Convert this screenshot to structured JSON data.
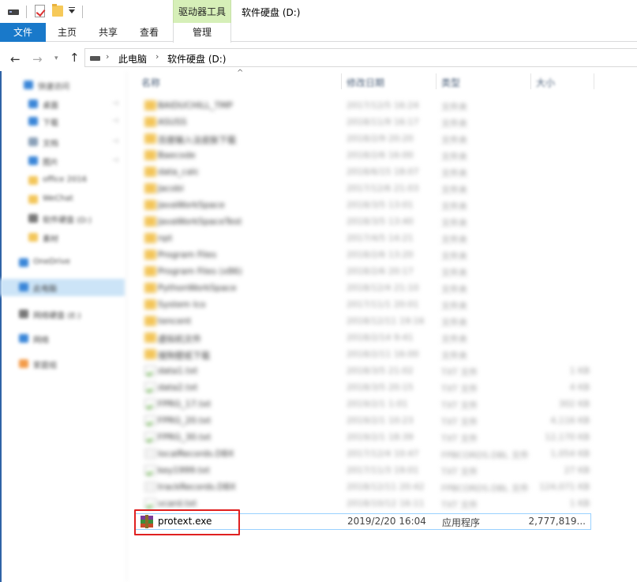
{
  "window": {
    "title": "软件硬盘 (D:)",
    "context_group": "驱动器工具"
  },
  "ribbon": {
    "tabs": [
      {
        "label": "文件",
        "active": true
      },
      {
        "label": "主页"
      },
      {
        "label": "共享"
      },
      {
        "label": "查看"
      },
      {
        "label": "管理"
      }
    ]
  },
  "address": {
    "crumbs": [
      "此电脑",
      "软件硬盘 (D:)"
    ]
  },
  "columns": {
    "name": "名称",
    "date": "修改日期",
    "type": "类型",
    "size": "大小"
  },
  "nav_pane": {
    "items": [
      {
        "label": "快速访问",
        "icon": "star-icon",
        "color": "#3a86d8"
      },
      {
        "label": "桌面",
        "icon": "desktop-icon",
        "color": "#3a86d8",
        "pinned": true
      },
      {
        "label": "下载",
        "icon": "download-icon",
        "color": "#3a86d8",
        "pinned": true
      },
      {
        "label": "文档",
        "icon": "document-icon",
        "color": "#8aa0b8",
        "pinned": true
      },
      {
        "label": "图片",
        "icon": "picture-icon",
        "color": "#3a86d8",
        "pinned": true
      },
      {
        "label": "office 2016",
        "icon": "folder-icon",
        "color": "#f3c65a"
      },
      {
        "label": "WeChat",
        "icon": "folder-icon",
        "color": "#f3c65a"
      },
      {
        "label": "软件硬盘 (D:)",
        "icon": "drive-icon",
        "color": "#777777"
      },
      {
        "label": "素材",
        "icon": "folder-icon",
        "color": "#f3c65a"
      },
      {
        "label": "OneDrive",
        "icon": "cloud-icon",
        "color": "#3a86d8"
      },
      {
        "label": "此电脑",
        "icon": "computer-icon",
        "color": "#3a86d8",
        "selected": true
      },
      {
        "label": "网络硬盘 (E:)",
        "icon": "drive-icon",
        "color": "#777777"
      },
      {
        "label": "网络",
        "icon": "network-icon",
        "color": "#3a86d8"
      },
      {
        "label": "家庭组",
        "icon": "homegroup-icon",
        "color": "#f39c4a"
      }
    ]
  },
  "files_blurred": [
    {
      "name": "BAIDUCHILL_TMP",
      "date": "2017/12/5 16:24",
      "type": "文件夹",
      "size": "",
      "kind": "folder"
    },
    {
      "name": "ASUSS",
      "date": "2018/11/9 16:17",
      "type": "文件夹",
      "size": "",
      "kind": "folder"
    },
    {
      "name": "百度输入法皮肤下载",
      "date": "2018/2/9 20:20",
      "type": "文件夹",
      "size": "",
      "kind": "folder"
    },
    {
      "name": "Baecode",
      "date": "2018/2/6 16:00",
      "type": "文件夹",
      "size": "",
      "kind": "folder"
    },
    {
      "name": "data_calc",
      "date": "2018/6/15 18:07",
      "type": "文件夹",
      "size": "",
      "kind": "folder"
    },
    {
      "name": "Jacobi",
      "date": "2017/12/6 21:03",
      "type": "文件夹",
      "size": "",
      "kind": "folder"
    },
    {
      "name": "JavaWorkSpace",
      "date": "2018/3/5 13:01",
      "type": "文件夹",
      "size": "",
      "kind": "folder"
    },
    {
      "name": "JavaWorkSpaceTest",
      "date": "2018/3/5 13:40",
      "type": "文件夹",
      "size": "",
      "kind": "folder"
    },
    {
      "name": "npt",
      "date": "2017/4/5 14:21",
      "type": "文件夹",
      "size": "",
      "kind": "folder"
    },
    {
      "name": "Program Files",
      "date": "2018/2/6 13:20",
      "type": "文件夹",
      "size": "",
      "kind": "folder"
    },
    {
      "name": "Program Files (x86)",
      "date": "2018/2/6 20:17",
      "type": "文件夹",
      "size": "",
      "kind": "folder"
    },
    {
      "name": "PythonWorkSpace",
      "date": "2018/12/4 21:10",
      "type": "文件夹",
      "size": "",
      "kind": "folder"
    },
    {
      "name": "System Ico",
      "date": "2017/11/1 20:01",
      "type": "文件夹",
      "size": "",
      "kind": "folder"
    },
    {
      "name": "tencent",
      "date": "2018/12/11 19:16",
      "type": "文件夹",
      "size": "",
      "kind": "folder"
    },
    {
      "name": "虚拟机文件",
      "date": "2018/2/14 9:41",
      "type": "文件夹",
      "size": "",
      "kind": "folder"
    },
    {
      "name": "搜狗壁纸下载",
      "date": "2018/2/11 16:00",
      "type": "文件夹",
      "size": "",
      "kind": "folder"
    },
    {
      "name": "data1.txt",
      "date": "2018/3/5 21:02",
      "type": "TXT 文件",
      "size": "1 KB",
      "kind": "txt"
    },
    {
      "name": "data2.txt",
      "date": "2018/3/5 20:15",
      "type": "TXT 文件",
      "size": "4 KB",
      "kind": "txt"
    },
    {
      "name": "FPRG_17.txt",
      "date": "2019/2/1 1:01",
      "type": "TXT 文件",
      "size": "302 KB",
      "kind": "txt"
    },
    {
      "name": "FPRG_20.txt",
      "date": "2019/2/1 10:23",
      "type": "TXT 文件",
      "size": "4,116 KB",
      "kind": "txt"
    },
    {
      "name": "FPRG_30.txt",
      "date": "2019/2/1 18:39",
      "type": "TXT 文件",
      "size": "12,170 KB",
      "kind": "txt"
    },
    {
      "name": "localRecords.DBX",
      "date": "2017/12/4 10:47",
      "type": "FPBCORDS.DBL 文件",
      "size": "1,054 KB",
      "kind": "doc"
    },
    {
      "name": "key1999.txt",
      "date": "2017/11/3 19:01",
      "type": "TXT 文件",
      "size": "27 KB",
      "kind": "txt"
    },
    {
      "name": "trackRecords.DBX",
      "date": "2018/12/11 20:42",
      "type": "FPBCORDS.DBL 文件",
      "size": "124,071 KB",
      "kind": "doc"
    },
    {
      "name": "vcard.txt",
      "date": "2018/10/12 16:11",
      "type": "TXT 文件",
      "size": "1 KB",
      "kind": "txt"
    }
  ],
  "selected_file": {
    "name": "protext.exe",
    "date": "2019/2/20 16:04",
    "type": "应用程序",
    "size": "2,777,819..."
  },
  "colors": {
    "accent": "#1979ca",
    "selection_border": "#99d1ff",
    "highlight": "#e02020",
    "context_tab": "#d6efb8"
  }
}
